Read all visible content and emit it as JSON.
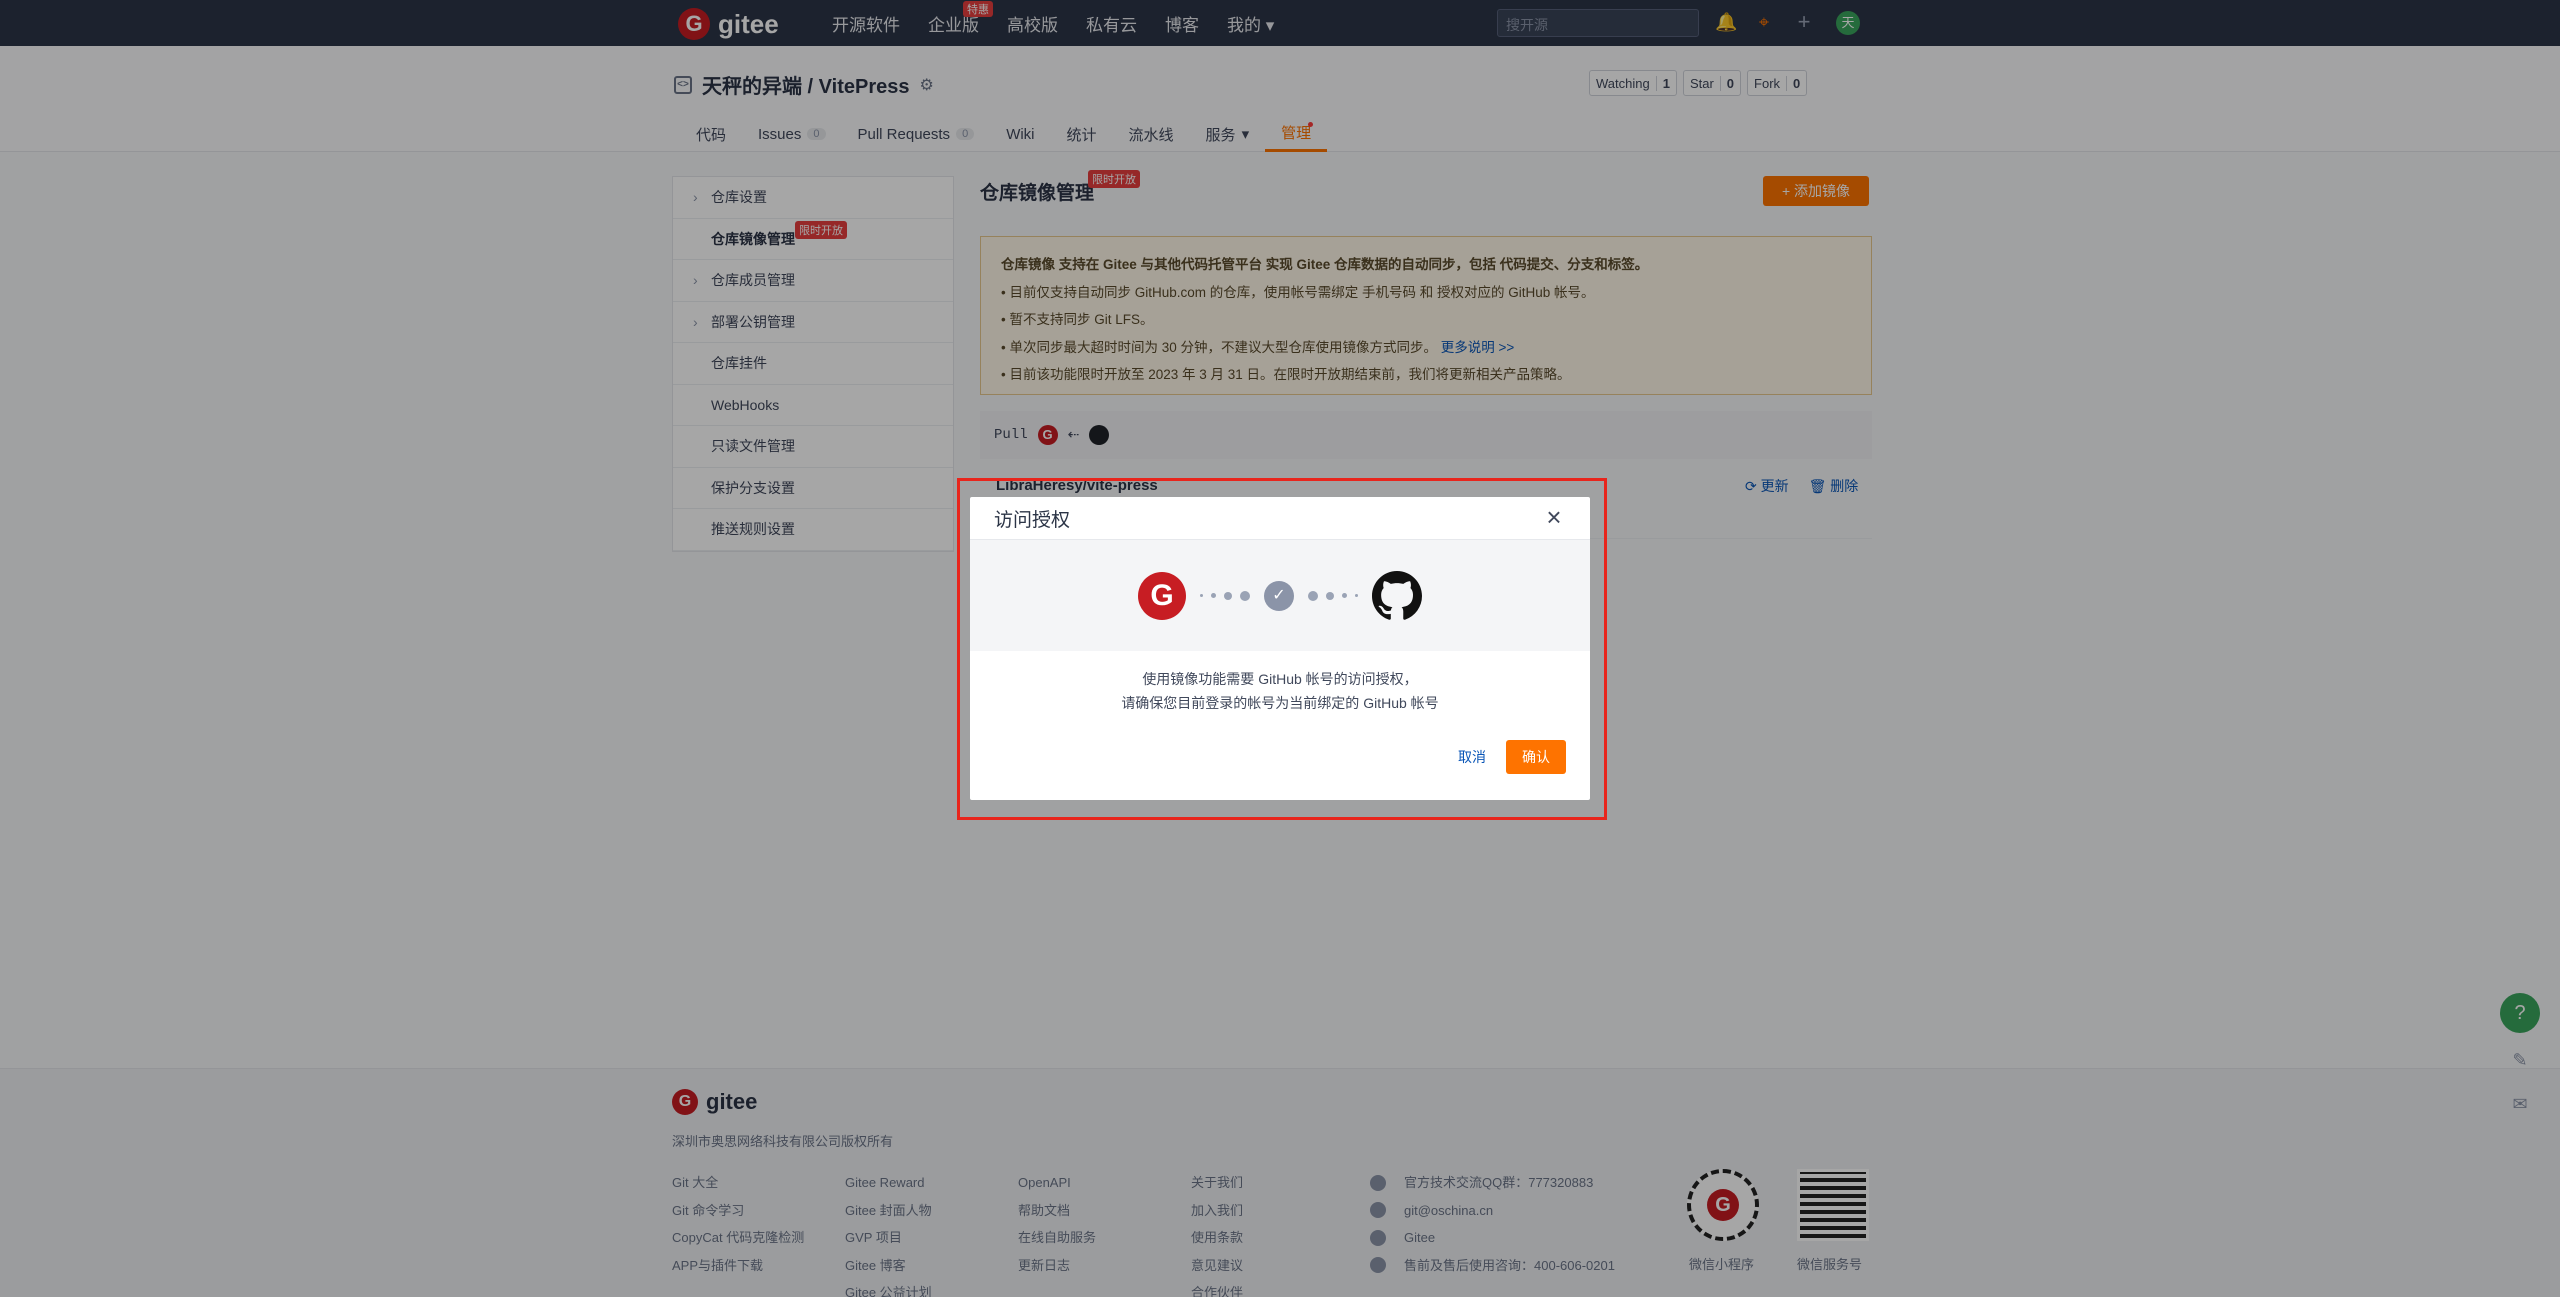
{
  "topnav": {
    "logo_text": "gitee",
    "links": [
      "开源软件",
      "企业版",
      "高校版",
      "私有云",
      "博客",
      "我的"
    ],
    "enterprise_badge": "特惠",
    "search_placeholder": "搜开源",
    "avatar_initial": "天"
  },
  "repo": {
    "title": "天秤的异端 / VitePress",
    "watching_label": "Watching",
    "watching_count": "1",
    "star_label": "Star",
    "star_count": "0",
    "fork_label": "Fork",
    "fork_count": "0",
    "tabs": [
      {
        "label": "代码"
      },
      {
        "label": "Issues",
        "count": "0"
      },
      {
        "label": "Pull Requests",
        "count": "0"
      },
      {
        "label": "Wiki"
      },
      {
        "label": "统计"
      },
      {
        "label": "流水线"
      },
      {
        "label": "服务"
      },
      {
        "label": "管理"
      }
    ]
  },
  "sidebar": {
    "items": [
      {
        "label": "仓库设置"
      },
      {
        "label": "仓库镜像管理",
        "badge": "限时开放"
      },
      {
        "label": "仓库成员管理"
      },
      {
        "label": "部署公钥管理"
      },
      {
        "label": "仓库挂件"
      },
      {
        "label": "WebHooks"
      },
      {
        "label": "只读文件管理"
      },
      {
        "label": "保护分支设置"
      },
      {
        "label": "推送规则设置"
      }
    ]
  },
  "main": {
    "title": "仓库镜像管理",
    "badge": "限时开放",
    "add_button": "+ 添加镜像",
    "notice_head": "仓库镜像 支持在 Gitee 与其他代码托管平台 实现 Gitee 仓库数据的自动同步，包括 代码提交、分支和标签。",
    "notice_items": [
      "目前仅支持自动同步 GitHub.com 的仓库，使用帐号需绑定 手机号码 和 授权对应的 GitHub 帐号。",
      "暂不支持同步 Git LFS。",
      "单次同步最大超时时间为 30 分钟，不建议大型仓库使用镜像方式同步。",
      "目前该功能限时开放至 2023 年 3 月 31 日。在限时开放期结束前，我们将更新相关产品策略。"
    ],
    "more_link": "更多说明 >>",
    "pull_label": "Pull",
    "arrow": "⇠",
    "mirror_name": "LibraHeresy/vite-press",
    "update_label": "更新",
    "delete_label": "删除"
  },
  "modal": {
    "title": "访问授权",
    "line1": "使用镜像功能需要 GitHub 帐号的访问授权，",
    "line2": "请确保您目前登录的帐号为当前绑定的 GitHub 帐号",
    "cancel": "取消",
    "confirm": "确认"
  },
  "footer": {
    "logo_text": "gitee",
    "copyright": "深圳市奥思网络科技有限公司版权所有",
    "col1": [
      "Git 大全",
      "Git 命令学习",
      "CopyCat 代码克隆检测",
      "APP与插件下载"
    ],
    "col2": [
      "Gitee Reward",
      "Gitee 封面人物",
      "GVP 项目",
      "Gitee 博客",
      "Gitee 公益计划"
    ],
    "col3": [
      "OpenAPI",
      "帮助文档",
      "在线自助服务",
      "更新日志"
    ],
    "col4": [
      "关于我们",
      "加入我们",
      "使用条款",
      "意见建议",
      "合作伙伴"
    ],
    "contacts": [
      "官方技术交流QQ群：777320883",
      "git@oschina.cn",
      "Gitee",
      "售前及售后使用咨询：400-606-0201"
    ],
    "qr1_label": "微信小程序",
    "qr2_label": "微信服务号"
  },
  "colors": {
    "accent": "#fe7300",
    "brand_red": "#c71d23",
    "nav_bg": "#2c3547",
    "highlight": "#e8251c"
  }
}
